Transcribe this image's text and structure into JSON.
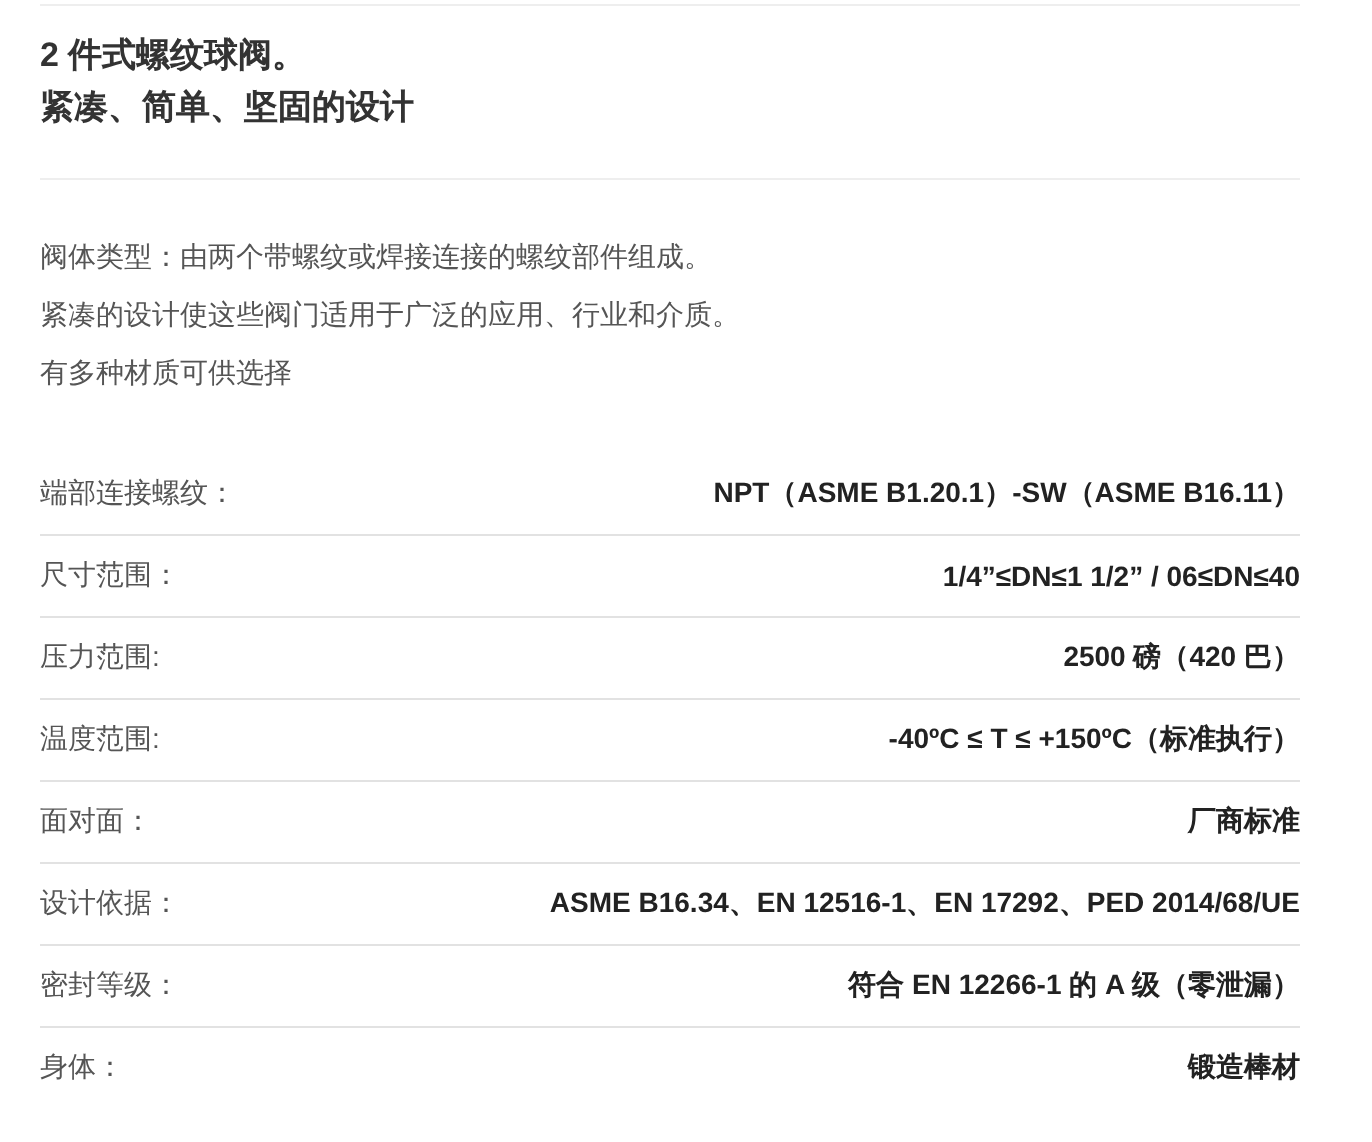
{
  "title_lines": [
    "2 件式螺纹球阀。",
    "紧凑、简单、坚固的设计"
  ],
  "paragraphs": [
    "阀体类型：由两个带螺纹或焊接连接的螺纹部件组成。",
    "紧凑的设计使这些阀门适用于广泛的应用、行业和介质。",
    "有多种材质可供选择"
  ],
  "specs": [
    {
      "label": "端部连接螺纹：",
      "value": "NPT（ASME B1.20.1）-SW（ASME B16.11）"
    },
    {
      "label": "尺寸范围：",
      "value": "1/4”≤DN≤1 1/2” / 06≤DN≤40"
    },
    {
      "label": "压力范围:",
      "value": "2500 磅（420 巴）"
    },
    {
      "label": "温度范围:",
      "value": "-40ºC ≤ T ≤ +150ºC（标准执行）"
    },
    {
      "label": "面对面：",
      "value": "厂商标准"
    },
    {
      "label": "设计依据：",
      "value": "ASME B16.34、EN 12516-1、EN 17292、PED 2014/68/UE"
    },
    {
      "label": "密封等级：",
      "value": "符合 EN 12266-1 的 A 级（零泄漏）"
    },
    {
      "label": "身体：",
      "value": "锻造棒材"
    }
  ]
}
